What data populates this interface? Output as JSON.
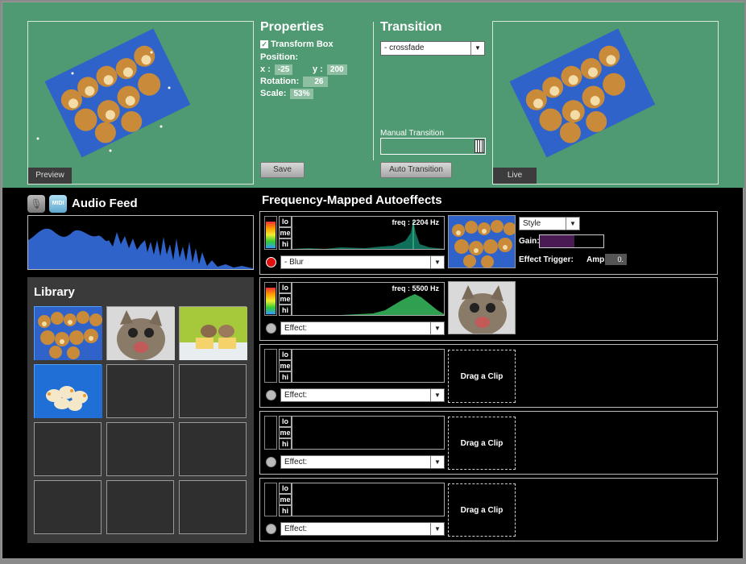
{
  "top": {
    "preview": {
      "label": "Preview"
    },
    "live": {
      "label": "Live"
    },
    "properties": {
      "title": "Properties",
      "transform_box": "Transform Box",
      "position_label": "Position:",
      "x_label": "x :",
      "x_value": "-25",
      "y_label": "y :",
      "y_value": "200",
      "rotation_label": "Rotation:",
      "rotation_value": "26",
      "scale_label": "Scale:",
      "scale_value": "53%",
      "save_label": "Save"
    },
    "transition": {
      "title": "Transition",
      "selected": "- crossfade",
      "manual_label": "Manual Transition",
      "manual_level": 0.85,
      "auto_label": "Auto Transition"
    }
  },
  "audio": {
    "mic_icon": "microphone-icon",
    "midi_label": "MIDI",
    "title": "Audio Feed"
  },
  "library": {
    "title": "Library",
    "items": [
      "puppies",
      "kitten",
      "bunnies",
      "chicks",
      "",
      "",
      "",
      "",
      "",
      "",
      "",
      ""
    ]
  },
  "autoeffects": {
    "title": "Frequency-Mapped Autoeffects",
    "lo": "lo",
    "me": "me",
    "hi": "hi",
    "rows": [
      {
        "freq": "freq : 2204 Hz",
        "effect": "- Blur",
        "active": true,
        "clip": "puppies"
      },
      {
        "freq": "freq : 5500 Hz",
        "effect": "Effect:",
        "active": false,
        "clip": "kitten"
      },
      {
        "freq": "",
        "effect": "Effect:",
        "active": false,
        "clip": "Drag a Clip"
      },
      {
        "freq": "",
        "effect": "Effect:",
        "active": false,
        "clip": "Drag a Clip"
      },
      {
        "freq": "",
        "effect": "Effect:",
        "active": false,
        "clip": "Drag a Clip"
      }
    ],
    "row1_controls": {
      "style_label": "Style",
      "gain_label": "Gain:",
      "gain_level": 0.55,
      "trigger_label": "Effect Trigger:",
      "amp_label": "Amp. ≥",
      "amp_value": "0."
    }
  },
  "colors": {
    "top_bg": "#4f9a72",
    "blue": "#2f63c9",
    "green": "#2ea04f",
    "gain": "#4a1a55"
  }
}
